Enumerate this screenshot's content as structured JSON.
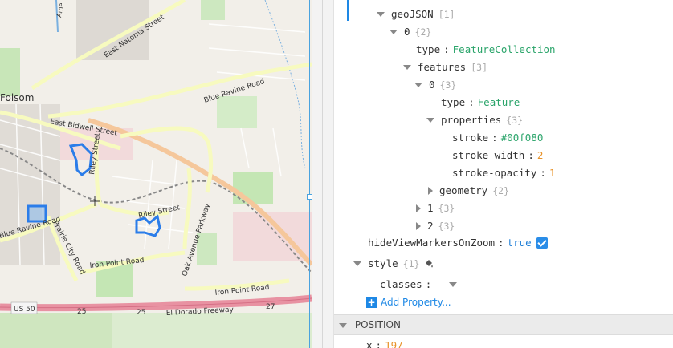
{
  "map": {
    "place_labels": {
      "folsom": "Folsom",
      "east_natoma": "East Natoma Street",
      "blue_ravine_top": "Blue Ravine Road",
      "east_bidwell": "East Bidwell Street",
      "riley_top": "Riley Street",
      "riley_bottom": "Riley Street",
      "blue_ravine_bottom": "Blue Ravine Road",
      "prairie_city": "Prairie City Road",
      "iron_point_left": "Iron Point Road",
      "iron_point_right": "Iron Point Road",
      "oak_avenue": "Oak Avenue Parkway",
      "el_dorado": "El Dorado Freeway",
      "us50": "US 50",
      "exit_25a": "25",
      "exit_25b": "25",
      "exit_27": "27",
      "american": "Ame"
    },
    "colors": {
      "feature_stroke": "#2b7de9",
      "freeway": "#e892a2",
      "primary_road": "#f7fabf"
    }
  },
  "tree": {
    "rows": [
      {
        "key": "geoJSON",
        "count": "[1]"
      },
      {
        "key": "0",
        "count": "{2}"
      },
      {
        "key": "type",
        "value": "FeatureCollection"
      },
      {
        "key": "features",
        "count": "[3]"
      },
      {
        "key": "0",
        "count": "{3}"
      },
      {
        "key": "type",
        "value": "Feature"
      },
      {
        "key": "properties",
        "count": "{3}"
      },
      {
        "key": "stroke",
        "value": "#00f080"
      },
      {
        "key": "stroke-width",
        "value": "2"
      },
      {
        "key": "stroke-opacity",
        "value": "1"
      },
      {
        "key": "geometry",
        "count": "{2}"
      },
      {
        "key": "1",
        "count": "{3}"
      },
      {
        "key": "2",
        "count": "{3}"
      },
      {
        "key": "hideViewMarkersOnZoom",
        "value": "true"
      },
      {
        "key": "style",
        "count": "{1}"
      },
      {
        "key": "classes",
        "value": ""
      }
    ],
    "add_property": "Add Property...",
    "position_header": "POSITION",
    "position_row": {
      "key": "x",
      "value": "197"
    }
  },
  "icons": {
    "link": "link-icon",
    "checkbox": "checkbox-checked-icon",
    "style": "paint-bucket-icon",
    "plus": "plus-icon"
  }
}
